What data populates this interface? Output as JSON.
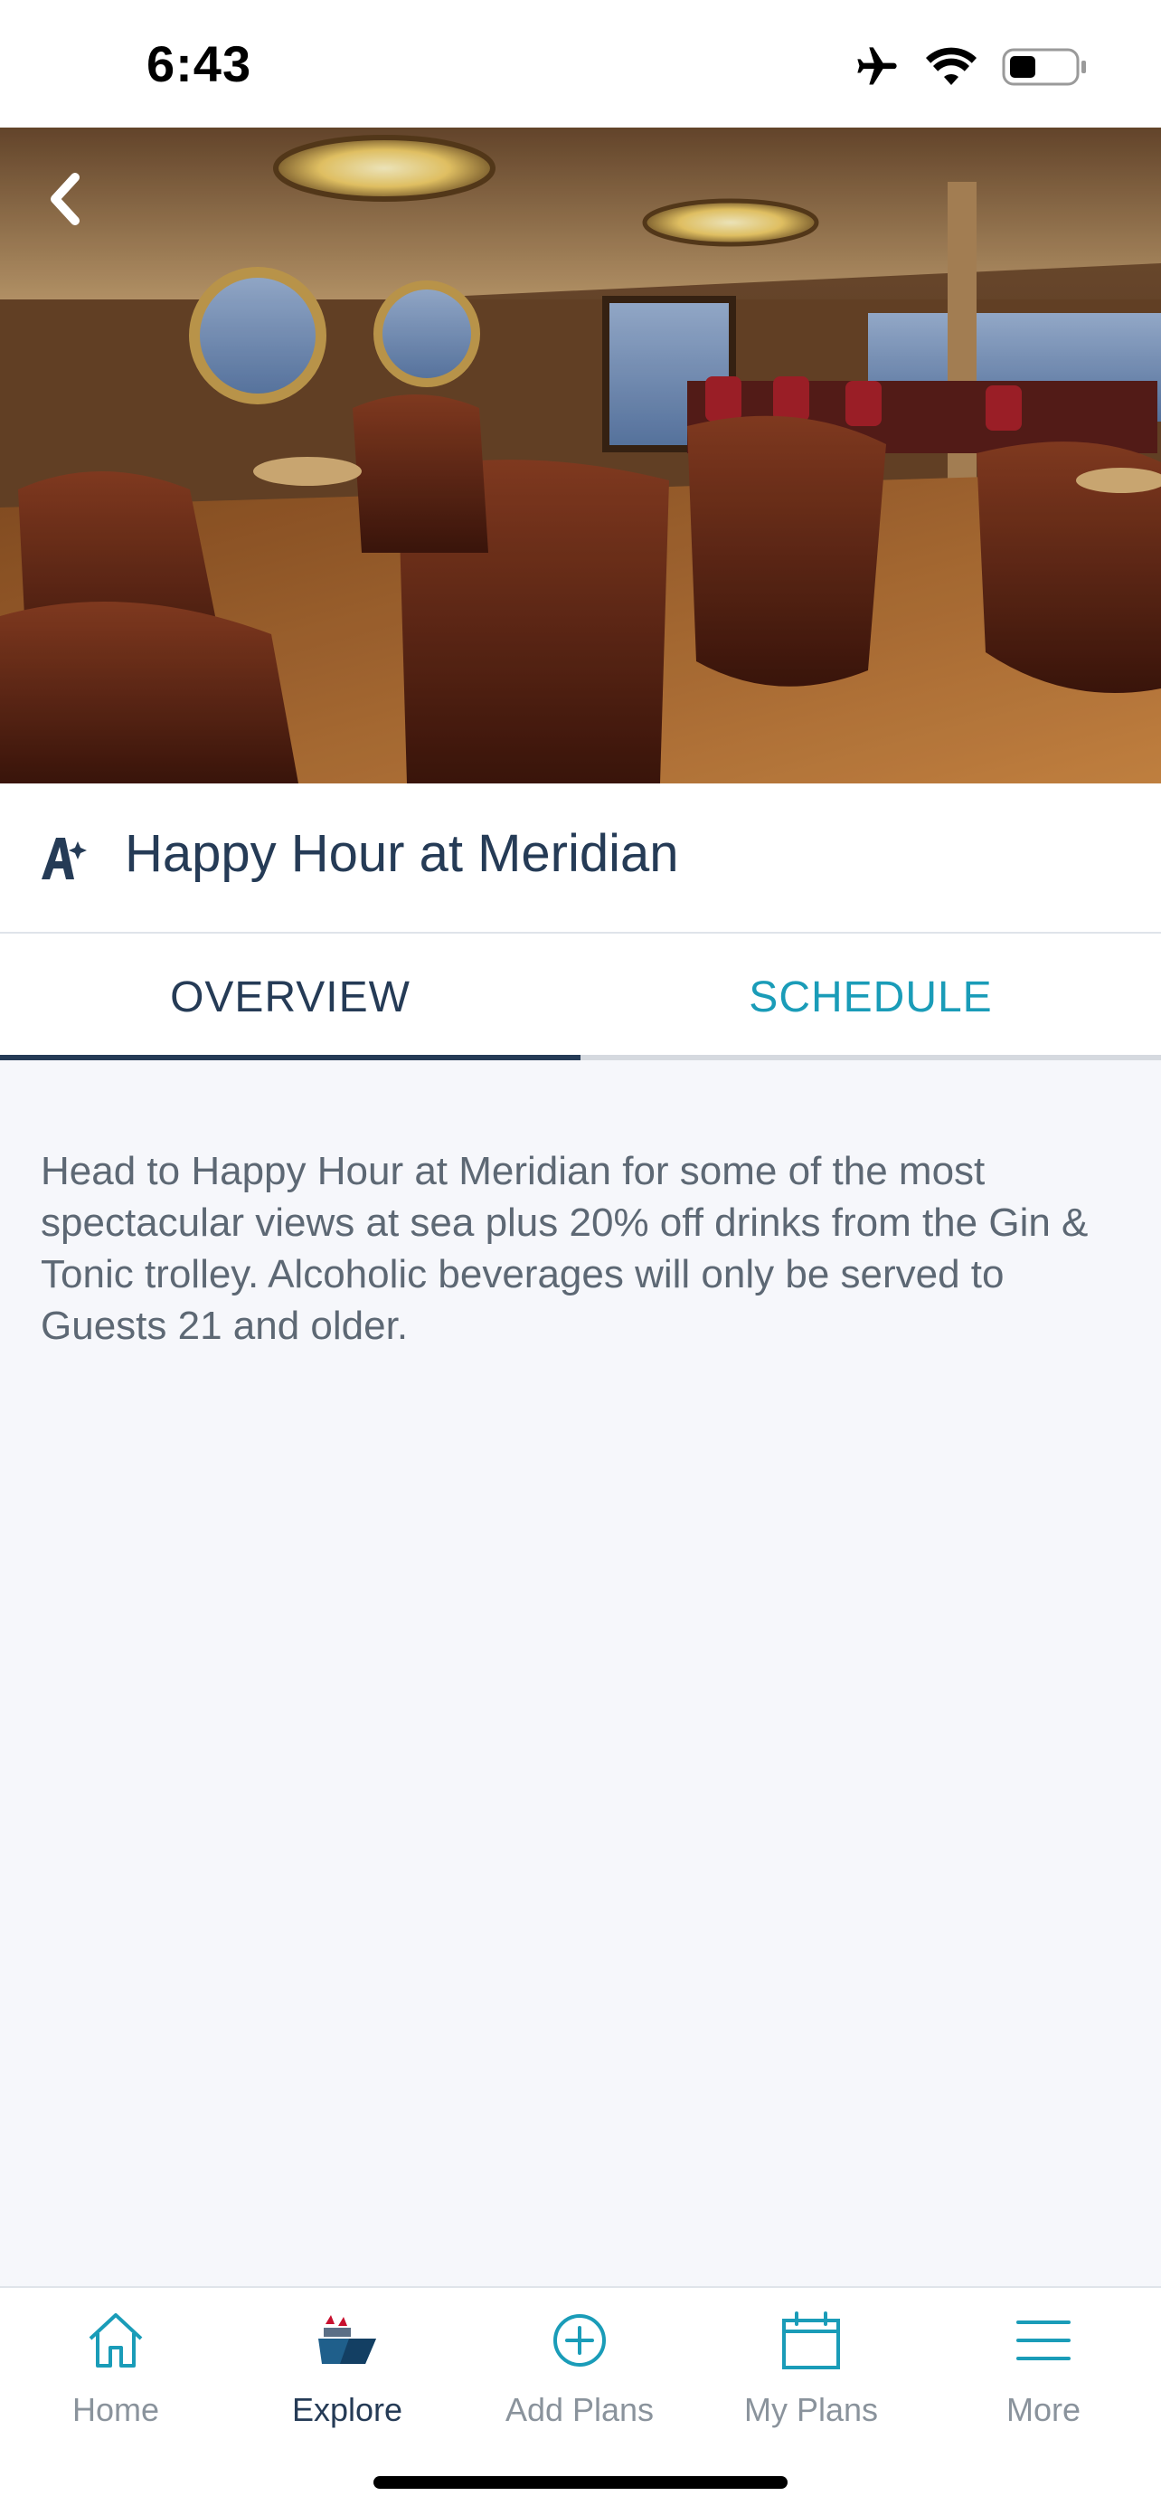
{
  "status_bar": {
    "time": "6:43",
    "icons": [
      "airplane-icon",
      "wifi-icon",
      "battery-icon"
    ]
  },
  "hero": {
    "image": "bar-lounge-photo",
    "back_icon": "chevron-left-icon"
  },
  "header": {
    "icon": "disney-a-sparkle-icon",
    "title": "Happy Hour at Meridian"
  },
  "tabs": [
    {
      "label": "OVERVIEW",
      "active": true
    },
    {
      "label": "SCHEDULE",
      "active": false
    }
  ],
  "overview": {
    "description": "Head to Happy Hour at Meridian for some of the most spectacular views at sea plus 20% off drinks from the Gin & Tonic trolley. Alcoholic beverages will only be served to Guests 21 and older."
  },
  "tab_bar": {
    "items": [
      {
        "label": "Home",
        "icon": "home-icon",
        "active": false
      },
      {
        "label": "Explore",
        "icon": "ship-icon",
        "active": true
      },
      {
        "label": "Add Plans",
        "icon": "plus-circle-icon",
        "active": false
      },
      {
        "label": "My Plans",
        "icon": "calendar-icon",
        "active": false
      },
      {
        "label": "More",
        "icon": "menu-icon",
        "active": false
      }
    ]
  },
  "colors": {
    "navy": "#253b56",
    "teal": "#1a9cb8",
    "gray_text": "#5d6874",
    "background": "#f6f7fb"
  }
}
